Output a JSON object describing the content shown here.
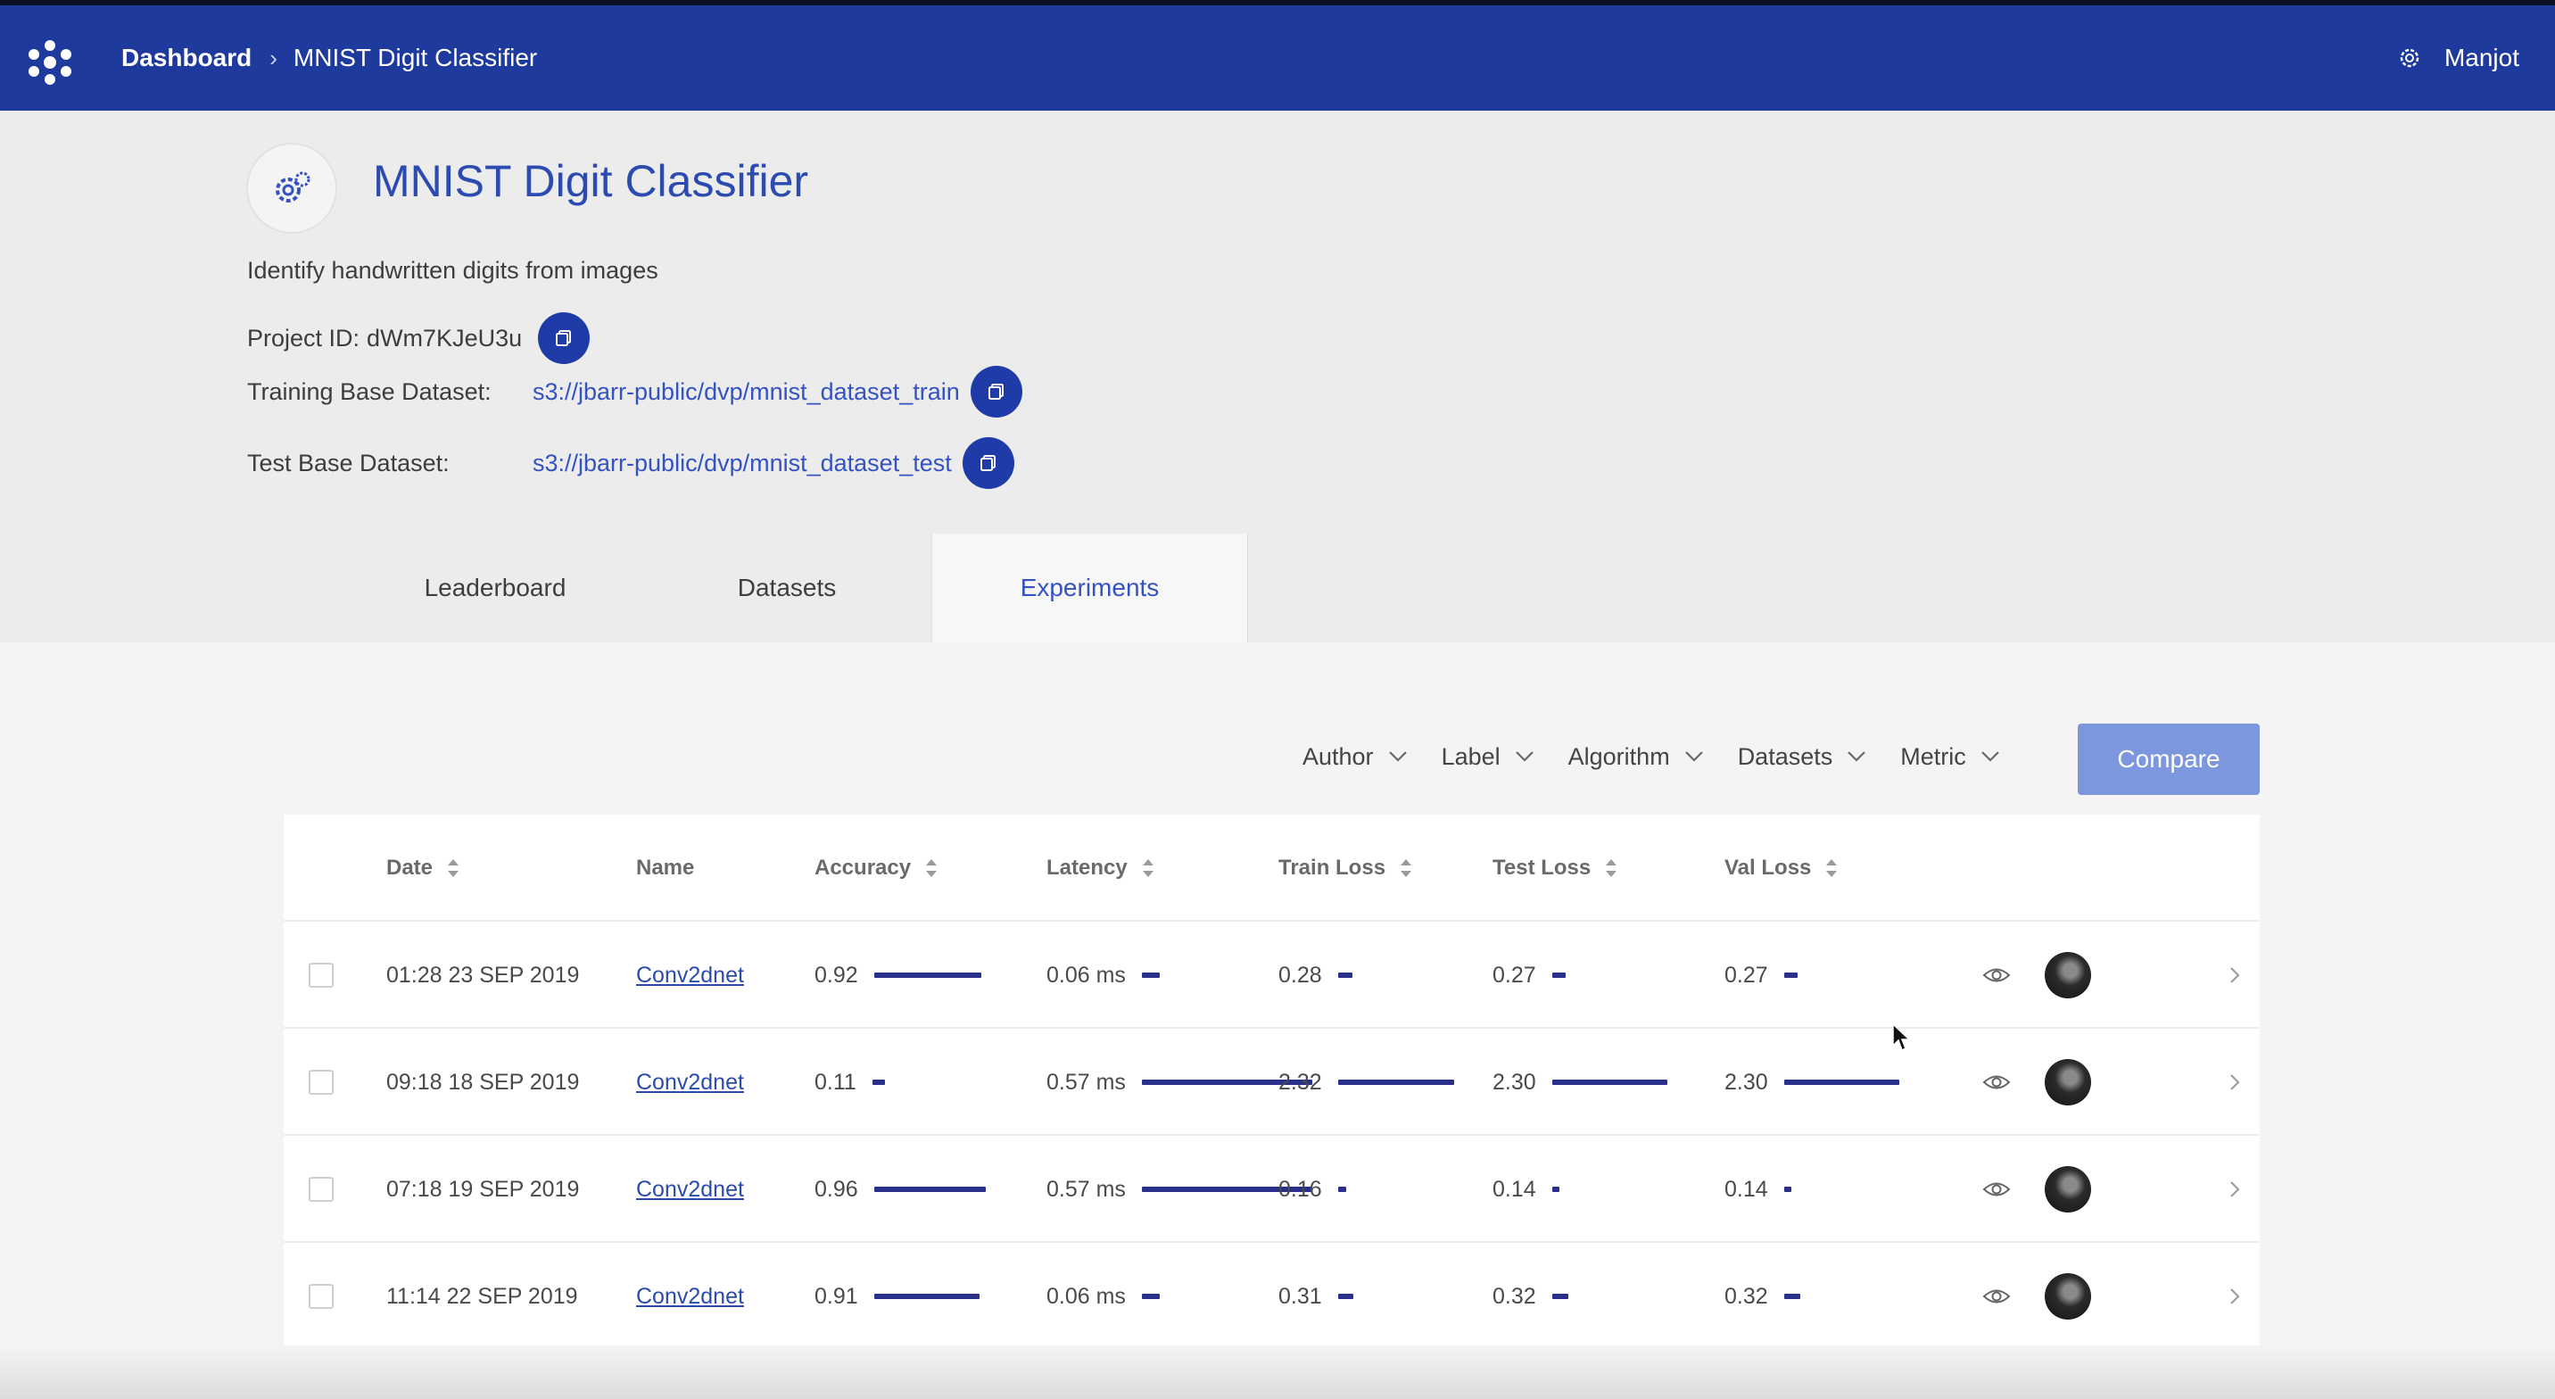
{
  "topbar": {
    "breadcrumb_home": "Dashboard",
    "breadcrumb_current": "MNIST Digit Classifier",
    "user_name": "Manjot",
    "brand_color": "#1d3a9c"
  },
  "project": {
    "title": "MNIST Digit Classifier",
    "description": "Identify handwritten digits from images",
    "project_id_label": "Project ID:",
    "project_id": "dWm7KJeU3u",
    "training_label": "Training Base Dataset:",
    "training_dataset": "s3://jbarr-public/dvp/mnist_dataset_train",
    "test_label": "Test Base Dataset:",
    "test_dataset": "s3://jbarr-public/dvp/mnist_dataset_test"
  },
  "tabs": [
    {
      "label": "Leaderboard",
      "active": false
    },
    {
      "label": "Datasets",
      "active": false
    },
    {
      "label": "Experiments",
      "active": true
    }
  ],
  "filters": {
    "author": "Author",
    "label": "Label",
    "algorithm": "Algorithm",
    "datasets": "Datasets",
    "metric": "Metric",
    "compare": "Compare"
  },
  "table": {
    "headers": {
      "date": "Date",
      "name": "Name",
      "accuracy": "Accuracy",
      "latency": "Latency",
      "train_loss": "Train Loss",
      "test_loss": "Test Loss",
      "val_loss": "Val Loss"
    },
    "rows": [
      {
        "date": "01:28 23 SEP 2019",
        "name": "Conv2dnet",
        "accuracy": "0.92",
        "latency": "0.06 ms",
        "train_loss": "0.28",
        "test_loss": "0.27",
        "val_loss": "0.27"
      },
      {
        "date": "09:18 18 SEP 2019",
        "name": "Conv2dnet",
        "accuracy": "0.11",
        "latency": "0.57 ms",
        "train_loss": "2.32",
        "test_loss": "2.30",
        "val_loss": "2.30"
      },
      {
        "date": "07:18 19 SEP 2019",
        "name": "Conv2dnet",
        "accuracy": "0.96",
        "latency": "0.57 ms",
        "train_loss": "0.16",
        "test_loss": "0.14",
        "val_loss": "0.14"
      },
      {
        "date": "11:14 22 SEP 2019",
        "name": "Conv2dnet",
        "accuracy": "0.91",
        "latency": "0.06 ms",
        "train_loss": "0.31",
        "test_loss": "0.32",
        "val_loss": "0.32"
      }
    ]
  },
  "icons": {
    "logo": "app-logo-icon",
    "settings": "gear-icon",
    "copy": "copy-icon",
    "view": "eye-icon",
    "sort": "sort-icon",
    "dropdown": "chevron-down-icon",
    "open": "chevron-right-icon"
  }
}
